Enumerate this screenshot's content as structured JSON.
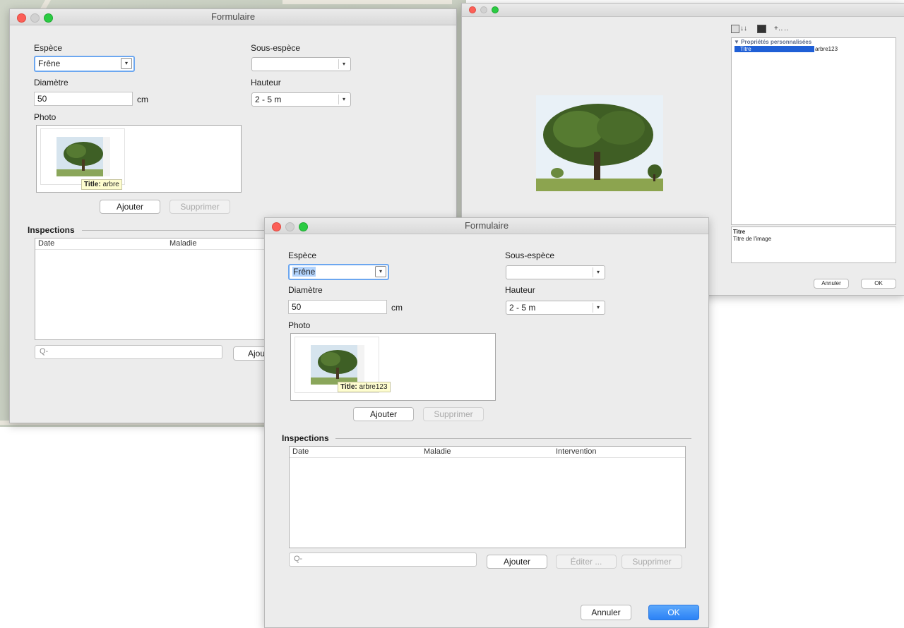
{
  "window_back": {
    "title": "Formulaire",
    "espece_label": "Espèce",
    "espece_value": "Frêne",
    "sous_espece_label": "Sous-espèce",
    "sous_espece_value": "",
    "diametre_label": "Diamètre",
    "diametre_value": "50",
    "diametre_unit": "cm",
    "hauteur_label": "Hauteur",
    "hauteur_value": "2 - 5 m",
    "photo_label": "Photo",
    "tooltip_key": "Title:",
    "tooltip_value": "arbre",
    "add_button": "Ajouter",
    "delete_button": "Supprimer",
    "inspections_label": "Inspections",
    "columns": [
      "Date",
      "Maladie"
    ],
    "add_button_2": "Ajou"
  },
  "image_props": {
    "toolbar_sort": "↓↓",
    "section_title": "Propriétés personnalisées",
    "property_key": "Titre",
    "property_value": "arbre123",
    "desc_title": "Titre",
    "desc_text": "Titre de l'image",
    "cancel_button": "Annuler",
    "ok_button": "OK"
  },
  "window_front": {
    "title": "Formulaire",
    "espece_label": "Espèce",
    "espece_value": "Frêne",
    "sous_espece_label": "Sous-espèce",
    "sous_espece_value": "",
    "diametre_label": "Diamètre",
    "diametre_value": "50",
    "diametre_unit": "cm",
    "hauteur_label": "Hauteur",
    "hauteur_value": "2 - 5 m",
    "photo_label": "Photo",
    "tooltip_key": "Title:",
    "tooltip_value": "arbre123",
    "add_button": "Ajouter",
    "delete_button": "Supprimer",
    "inspections_label": "Inspections",
    "columns": [
      "Date",
      "Maladie",
      "Intervention"
    ],
    "search_placeholder": "",
    "table_add_button": "Ajouter",
    "table_edit_button": "Éditer ...",
    "table_delete_button": "Supprimer",
    "cancel_button": "Annuler",
    "ok_button": "OK"
  },
  "icons": {
    "dropdown": "▾",
    "search": "Q-",
    "triangle": "▼"
  }
}
